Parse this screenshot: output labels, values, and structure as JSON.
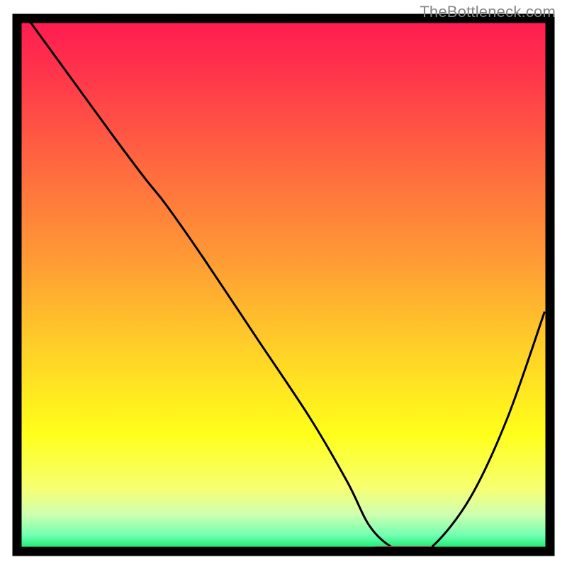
{
  "watermark": "TheBottleneck.com",
  "chart_data": {
    "type": "line",
    "title": "",
    "xlabel": "",
    "ylabel": "",
    "xlim": [
      0,
      100
    ],
    "ylim": [
      0,
      100
    ],
    "grid": false,
    "series": [
      {
        "name": "curve",
        "x": [
          2,
          10,
          18,
          24,
          28,
          35,
          45,
          55,
          62,
          66,
          70,
          74,
          78,
          85,
          92,
          99
        ],
        "y": [
          100,
          89,
          78,
          70,
          65,
          55,
          40,
          25,
          13,
          5,
          1,
          0,
          1,
          10,
          25,
          45
        ]
      }
    ],
    "marker": {
      "name": "optimal-region",
      "x_start": 67,
      "x_end": 78,
      "y": 0.5,
      "color": "#d46a6a"
    },
    "gradient_stops": [
      {
        "offset": 0.0,
        "color": "#ff1a52"
      },
      {
        "offset": 0.12,
        "color": "#ff3a4a"
      },
      {
        "offset": 0.28,
        "color": "#ff6a3f"
      },
      {
        "offset": 0.45,
        "color": "#ff9a35"
      },
      {
        "offset": 0.62,
        "color": "#ffd028"
      },
      {
        "offset": 0.78,
        "color": "#ffff1a"
      },
      {
        "offset": 0.88,
        "color": "#f7ff70"
      },
      {
        "offset": 0.93,
        "color": "#d0ffb0"
      },
      {
        "offset": 0.97,
        "color": "#70ffb0"
      },
      {
        "offset": 1.0,
        "color": "#00e860"
      }
    ]
  }
}
